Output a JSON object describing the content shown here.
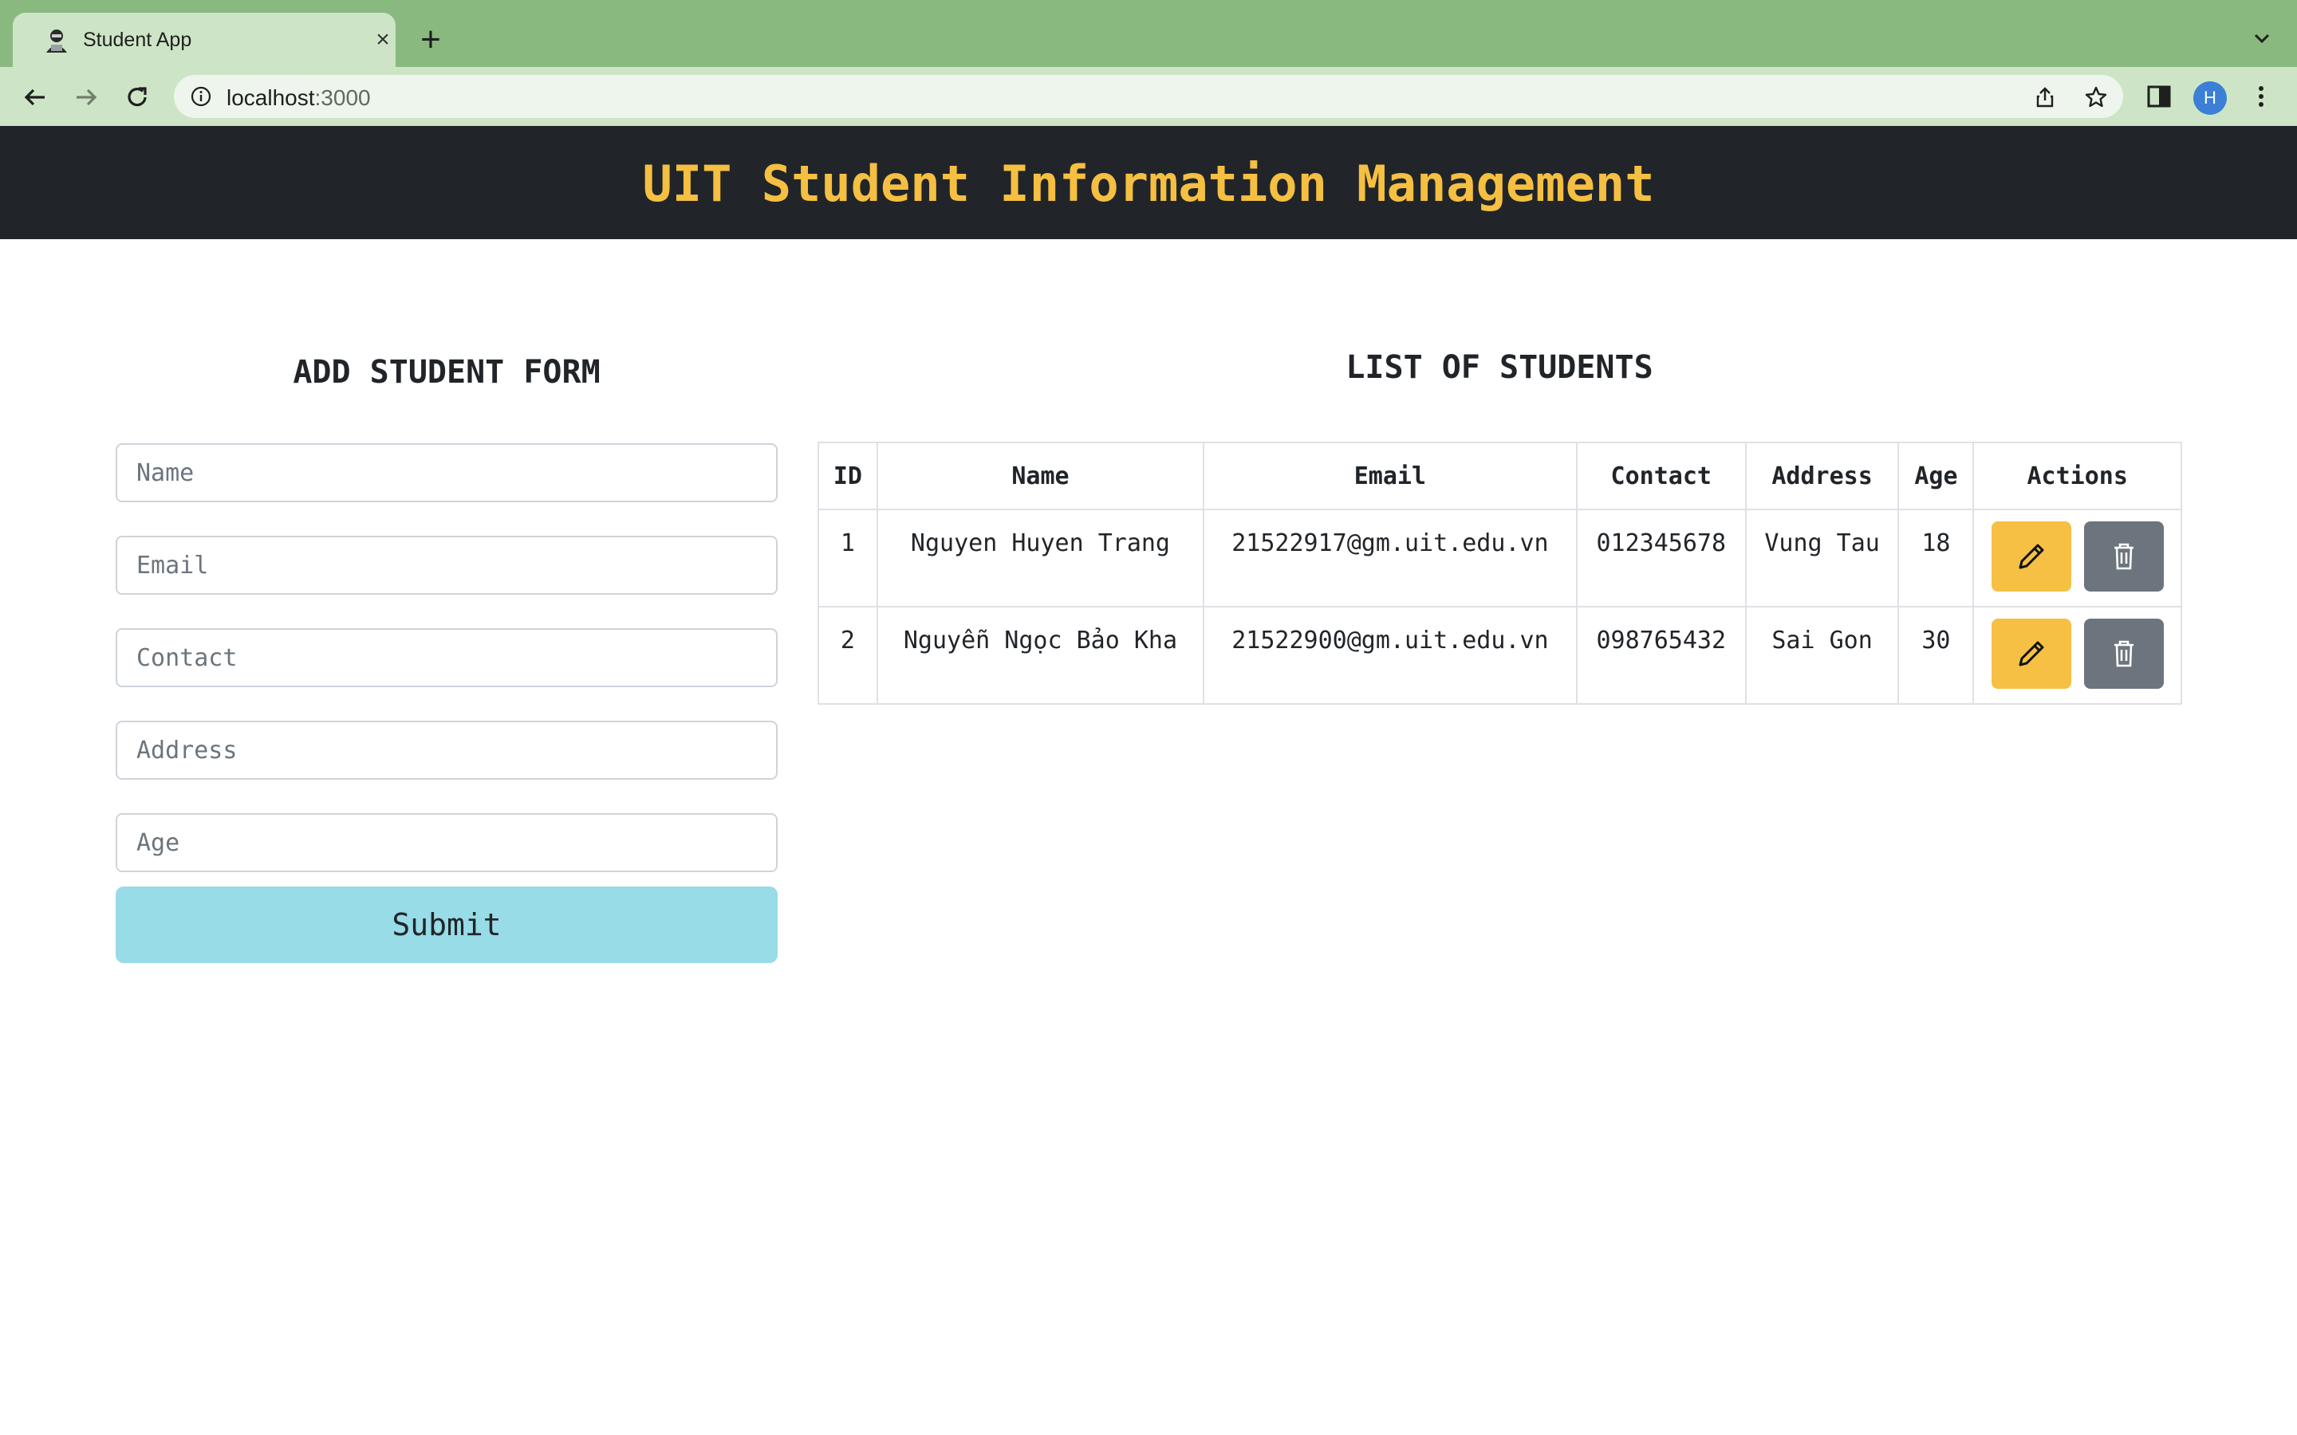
{
  "browser": {
    "tab_title": "Student App",
    "url_host": "localhost",
    "url_port": ":3000",
    "profile_initial": "H"
  },
  "app": {
    "title": "UIT Student Information Management"
  },
  "form": {
    "title": "ADD STUDENT FORM",
    "fields": [
      {
        "placeholder": "Name",
        "value": ""
      },
      {
        "placeholder": "Email",
        "value": ""
      },
      {
        "placeholder": "Contact",
        "value": ""
      },
      {
        "placeholder": "Address",
        "value": ""
      },
      {
        "placeholder": "Age",
        "value": ""
      }
    ],
    "submit_label": "Submit"
  },
  "list": {
    "title": "LIST OF STUDENTS",
    "columns": [
      "ID",
      "Name",
      "Email",
      "Contact",
      "Address",
      "Age",
      "Actions"
    ],
    "rows": [
      {
        "id": "1",
        "name": "Nguyen Huyen Trang",
        "email": "21522917@gm.uit.edu.vn",
        "contact": "012345678",
        "address": "Vung Tau",
        "age": "18"
      },
      {
        "id": "2",
        "name": "Nguyễn Ngọc Bảo Kha",
        "email": "21522900@gm.uit.edu.vn",
        "contact": "098765432",
        "address": "Sai Gon",
        "age": "30"
      }
    ]
  },
  "colors": {
    "tab_strip": "#89b97f",
    "toolbar": "#cde5c6",
    "header_bg": "#212529",
    "title_accent": "#f5bf42",
    "submit_bg": "#97dce6",
    "edit_bg": "#f5c043",
    "delete_bg": "#6c757d"
  },
  "icons": [
    "hacker-favicon-icon",
    "close-icon",
    "plus-icon",
    "chevron-down-icon",
    "back-arrow-icon",
    "forward-arrow-icon",
    "reload-icon",
    "info-icon",
    "share-icon",
    "star-icon",
    "side-panel-icon",
    "kebab-menu-icon",
    "pencil-icon",
    "trash-icon"
  ]
}
